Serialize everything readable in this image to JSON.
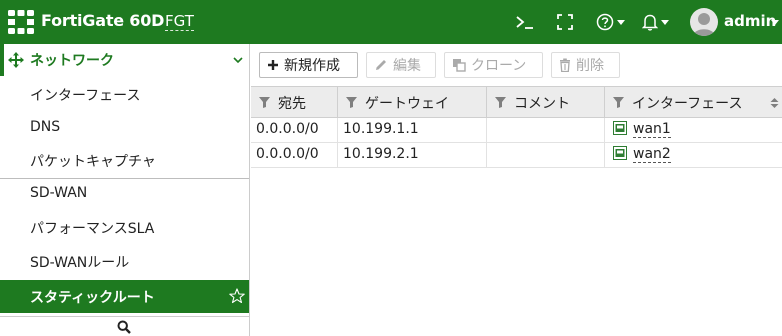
{
  "topbar": {
    "brand": "FortiGate 60D",
    "hostname": "FGT",
    "username": "admin",
    "icons": [
      "fortinet-logo-icon",
      "cli-icon",
      "fullscreen-icon",
      "help-icon",
      "bell-icon",
      "avatar"
    ]
  },
  "sidebar": {
    "section": {
      "label": "ネットワーク",
      "icon": "move-icon",
      "expanded": true
    },
    "items": [
      {
        "label": "インターフェース"
      },
      {
        "label": "DNS"
      },
      {
        "label": "パケットキャプチャ"
      },
      {
        "label": "SD-WAN"
      },
      {
        "label": "パフォーマンスSLA"
      },
      {
        "label": "SD-WANルール"
      },
      {
        "label": "スタティックルート",
        "active": true,
        "favorite_icon": "star-icon"
      }
    ],
    "search_icon": "search-icon"
  },
  "toolbar": {
    "create": "新規作成",
    "edit": "編集",
    "clone": "クローン",
    "delete": "削除"
  },
  "table": {
    "columns": [
      "宛先",
      "ゲートウェイ",
      "コメント",
      "インターフェース"
    ],
    "rows": [
      {
        "destination": "0.0.0.0/0",
        "gateway": "10.199.1.1",
        "comment": "",
        "interface": "wan1"
      },
      {
        "destination": "0.0.0.0/0",
        "gateway": "10.199.2.1",
        "comment": "",
        "interface": "wan2"
      }
    ]
  },
  "colors": {
    "brand_green": "#1e7a20",
    "header_bg": "#ececec"
  }
}
